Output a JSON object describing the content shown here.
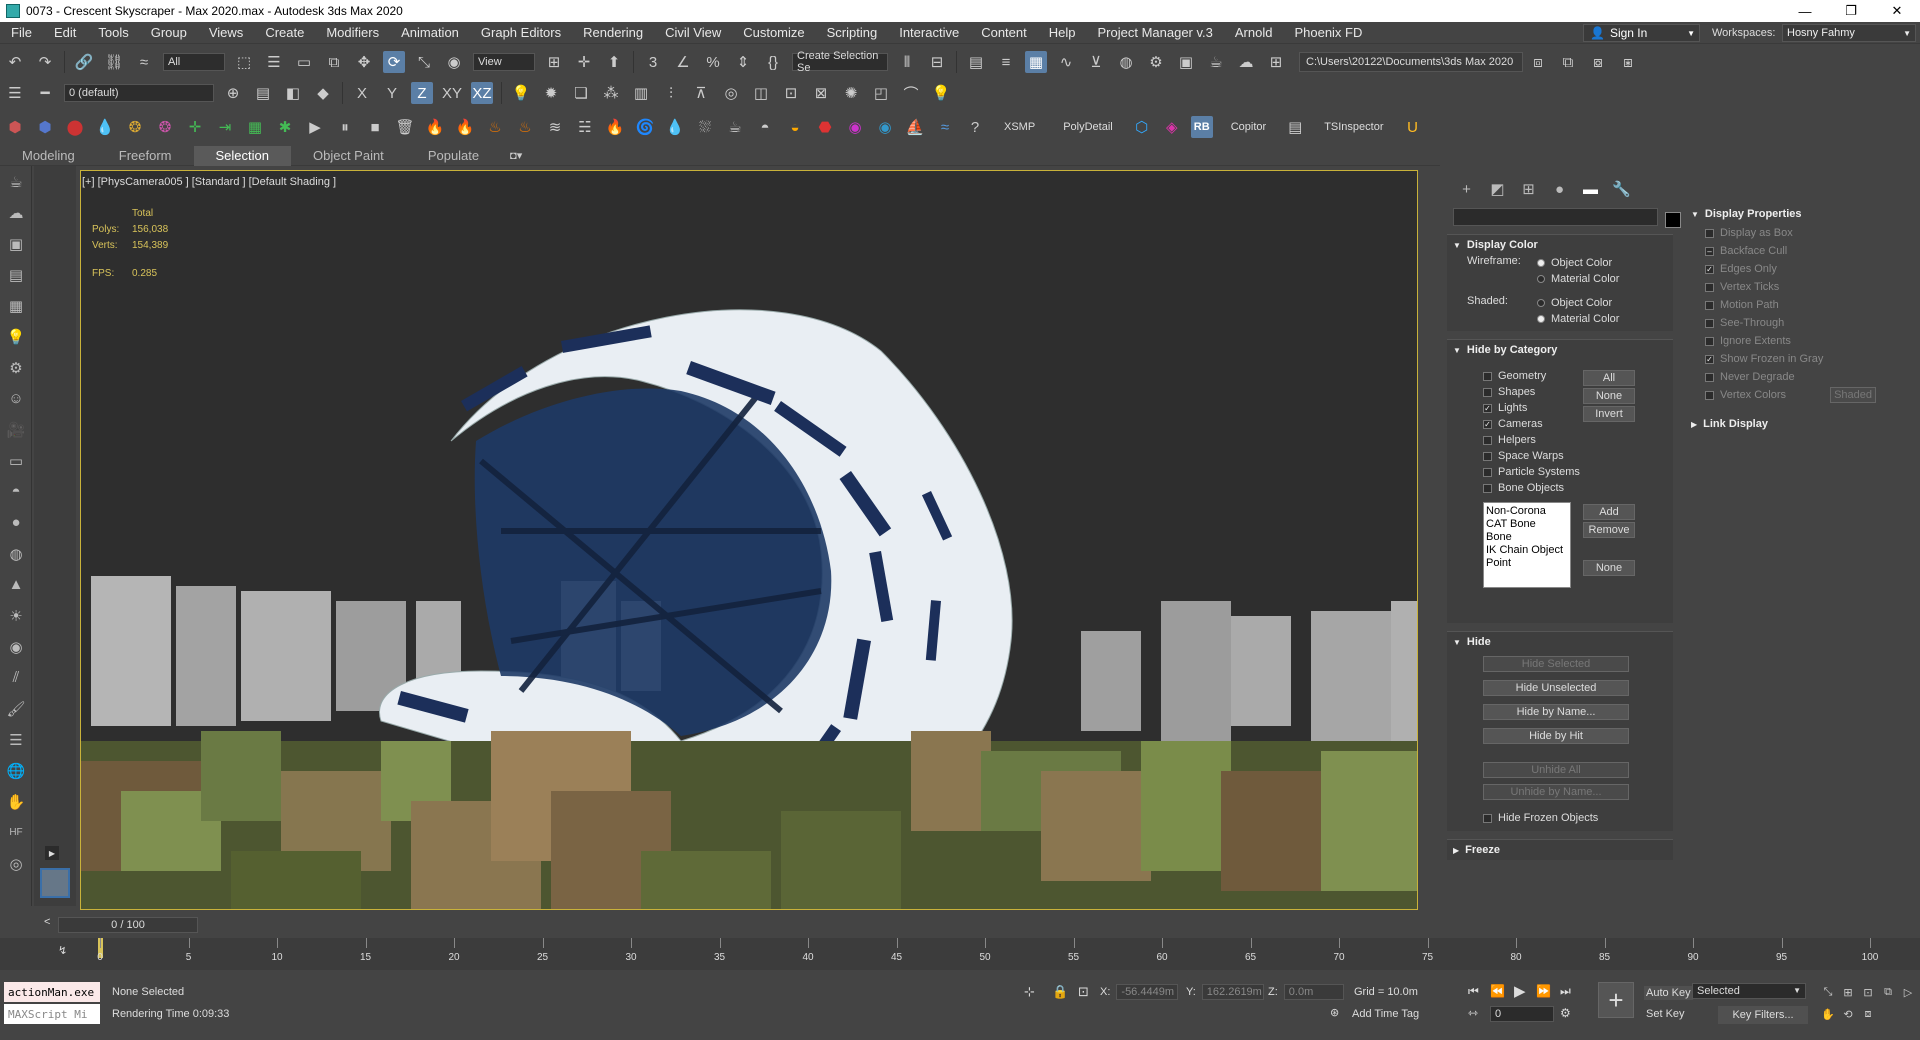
{
  "title_bar": {
    "title": "0073 - Crescent Skyscraper - Max 2020.max - Autodesk 3ds Max 2020",
    "minimize": "—",
    "maximize": "❐",
    "close": "✕"
  },
  "menu": [
    "File",
    "Edit",
    "Tools",
    "Group",
    "Views",
    "Create",
    "Modifiers",
    "Animation",
    "Graph Editors",
    "Rendering",
    "Civil View",
    "Customize",
    "Scripting",
    "Interactive",
    "Content",
    "Help",
    "Project Manager v.3",
    "Arnold",
    "Phoenix FD"
  ],
  "account": {
    "sign_in": "Sign In",
    "workspaces_label": "Workspaces:",
    "workspace": "Hosny Fahmy"
  },
  "toolbar1": {
    "filter_all": "All",
    "view": "View",
    "selection_set": "Create Selection Se",
    "path": "C:\\Users\\20122\\Documents\\3ds Max 2020"
  },
  "toolbar2": {
    "layer": "0 (default)",
    "x": "X",
    "y": "Y",
    "z": "Z",
    "xy": "XY",
    "xz": "XZ"
  },
  "toolbar3": {
    "xsmp": "XSMP",
    "polydetail": "PolyDetail",
    "rb": "RB",
    "copitor": "Copitor",
    "tsinspector": "TSInspector"
  },
  "ribbon": {
    "tabs": [
      "Modeling",
      "Freeform",
      "Selection",
      "Object Paint",
      "Populate"
    ],
    "active": "Selection"
  },
  "viewport": {
    "label": "[+] [PhysCamera005 ] [Standard ] [Default Shading ]",
    "stats": {
      "total_label": "Total",
      "polys_label": "Polys:",
      "polys": "156,038",
      "verts_label": "Verts:",
      "verts": "154,389",
      "fps_label": "FPS:",
      "fps": "0.285"
    }
  },
  "display_color": {
    "title": "Display Color",
    "wireframe_label": "Wireframe:",
    "shaded_label": "Shaded:",
    "object_color": "Object Color",
    "material_color": "Material Color"
  },
  "hide_by_category": {
    "title": "Hide by Category",
    "items": [
      {
        "label": "Geometry",
        "checked": false
      },
      {
        "label": "Shapes",
        "checked": false
      },
      {
        "label": "Lights",
        "checked": true
      },
      {
        "label": "Cameras",
        "checked": true
      },
      {
        "label": "Helpers",
        "checked": false
      },
      {
        "label": "Space Warps",
        "checked": false
      },
      {
        "label": "Particle Systems",
        "checked": false
      },
      {
        "label": "Bone Objects",
        "checked": false
      }
    ],
    "btn_all": "All",
    "btn_none": "None",
    "btn_invert": "Invert",
    "list": [
      "Non-Corona",
      "CAT Bone",
      "Bone",
      "IK Chain Object",
      "Point"
    ],
    "btn_add": "Add",
    "btn_remove": "Remove",
    "btn_none2": "None"
  },
  "hide": {
    "title": "Hide",
    "hide_selected": "Hide Selected",
    "hide_unselected": "Hide Unselected",
    "hide_by_name": "Hide by Name...",
    "hide_by_hit": "Hide by Hit",
    "unhide_all": "Unhide All",
    "unhide_by_name": "Unhide by Name...",
    "hide_frozen": "Hide Frozen Objects"
  },
  "freeze": {
    "title": "Freeze"
  },
  "display_properties": {
    "title": "Display Properties",
    "items": [
      {
        "label": "Display as Box",
        "checked": false
      },
      {
        "label": "Backface Cull",
        "checked": true
      },
      {
        "label": "Edges Only",
        "checked": true
      },
      {
        "label": "Vertex Ticks",
        "checked": false
      },
      {
        "label": "Motion Path",
        "checked": false
      },
      {
        "label": "See-Through",
        "checked": false
      },
      {
        "label": "Ignore Extents",
        "checked": false
      },
      {
        "label": "Show Frozen in Gray",
        "checked": true
      },
      {
        "label": "Never Degrade",
        "checked": false
      },
      {
        "label": "Vertex Colors",
        "checked": false
      }
    ],
    "shaded_btn": "Shaded"
  },
  "link_display": {
    "title": "Link Display"
  },
  "timeline": {
    "slider": "0 / 100",
    "ticks": [
      "0",
      "5",
      "10",
      "15",
      "20",
      "25",
      "30",
      "35",
      "40",
      "45",
      "50",
      "55",
      "60",
      "65",
      "70",
      "75",
      "80",
      "85",
      "90",
      "95",
      "100"
    ]
  },
  "status": {
    "maxscript1": "actionMan.exe",
    "maxscript2": "MAXScript Mi",
    "selection": "None Selected",
    "render_time": "Rendering Time  0:09:33",
    "x_label": "X:",
    "x": "-56.4449m",
    "y_label": "Y:",
    "y": "162.2619m",
    "z_label": "Z:",
    "z": "0.0m",
    "grid": "Grid = 10.0m",
    "add_time_tag": "Add Time Tag",
    "auto_key": "Auto Key",
    "selected": "Selected",
    "set_key": "Set Key",
    "key_filters": "Key Filters...",
    "frame": "0"
  }
}
